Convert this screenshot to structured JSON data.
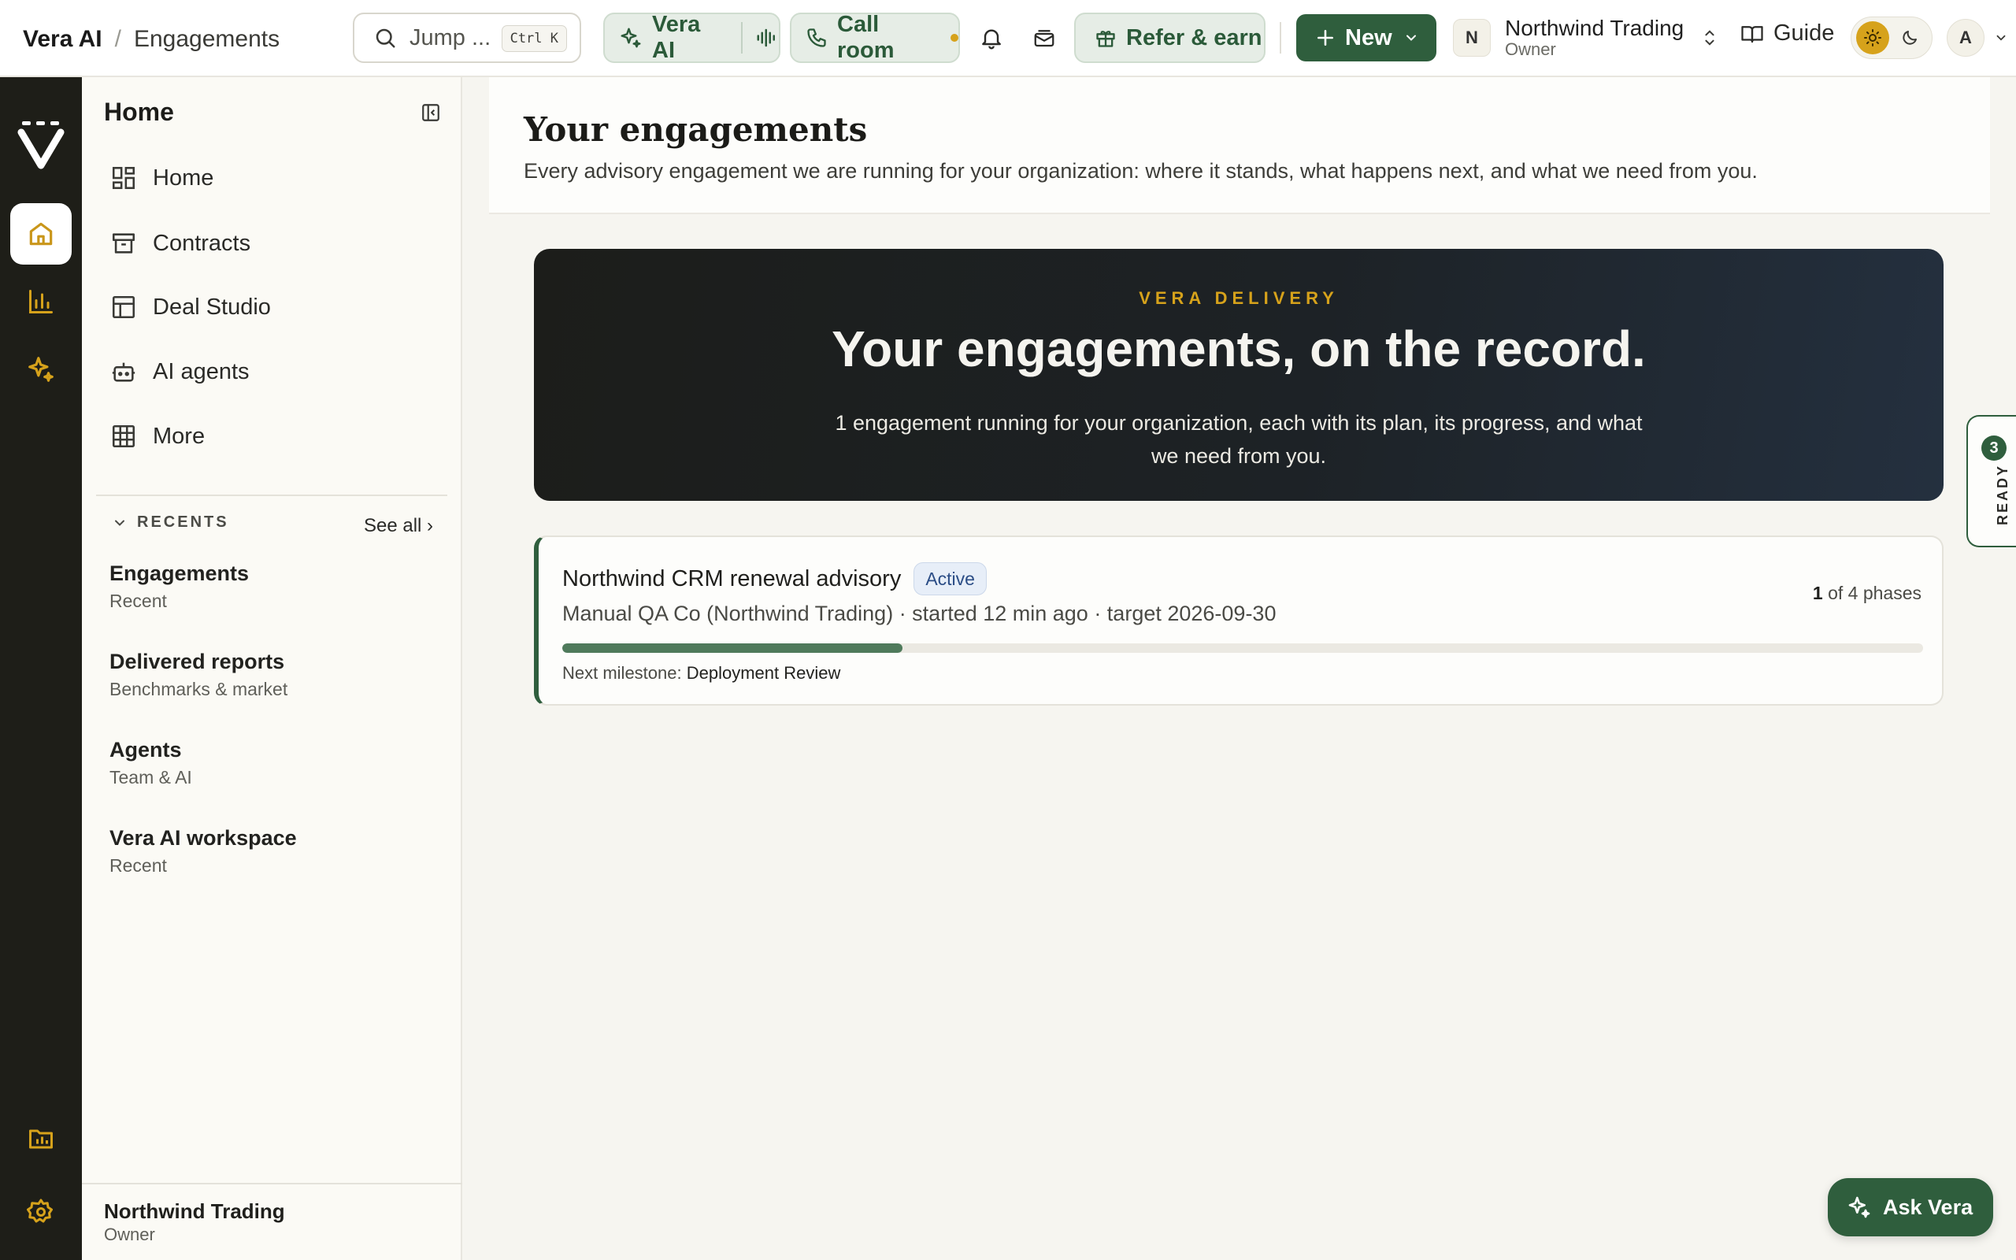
{
  "breadcrumb": {
    "app": "Vera AI",
    "separator": "/",
    "current": "Engagements"
  },
  "search": {
    "placeholder": "Jump ...",
    "shortcut": "Ctrl K"
  },
  "topbar": {
    "vera_ai_label": "Vera AI",
    "call_room_label": "Call room",
    "refer_label": "Refer & earn",
    "new_label": "New",
    "guide_label": "Guide"
  },
  "org": {
    "initial": "N",
    "name": "Northwind Trading",
    "role": "Owner"
  },
  "user": {
    "initial": "A"
  },
  "sidebar": {
    "title": "Home",
    "items": [
      {
        "label": "Home",
        "icon": "dashboard-icon"
      },
      {
        "label": "Contracts",
        "icon": "archive-icon"
      },
      {
        "label": "Deal Studio",
        "icon": "layout-icon"
      },
      {
        "label": "AI agents",
        "icon": "bot-icon"
      },
      {
        "label": "More",
        "icon": "grid-icon"
      }
    ],
    "recents_label": "RECENTS",
    "see_all": "See all ›",
    "recents": [
      {
        "title": "Engagements",
        "subtitle": "Recent"
      },
      {
        "title": "Delivered reports",
        "subtitle": "Benchmarks & market"
      },
      {
        "title": "Agents",
        "subtitle": "Team & AI"
      },
      {
        "title": "Vera AI workspace",
        "subtitle": "Recent"
      }
    ],
    "footer": {
      "name": "Northwind Trading",
      "role": "Owner"
    }
  },
  "page": {
    "title": "Your engagements",
    "subtitle": "Every advisory engagement we are running for your organization: where it stands, what happens next, and what we need from you."
  },
  "hero": {
    "eyebrow": "VERA DELIVERY",
    "title": "Your engagements, on the record.",
    "subtitle": "1 engagement running for your organization, each with its plan, its progress, and what we need from you."
  },
  "engagement": {
    "title": "Northwind CRM renewal advisory",
    "status": "Active",
    "meta": "Manual QA Co (Northwind Trading) · started 12 min ago · target 2026-09-30",
    "phase_current": "1",
    "phase_rest": " of 4 phases",
    "progress_fraction": 0.25,
    "milestone_label": "Next milestone: ",
    "milestone_value": "Deployment Review"
  },
  "ready": {
    "count": "3",
    "label": "READY"
  },
  "ask": {
    "label": "Ask Vera"
  },
  "colors": {
    "brand_green": "#2f5e3d",
    "accent_gold": "#d6a21b",
    "rail_dark": "#1e1e18"
  }
}
